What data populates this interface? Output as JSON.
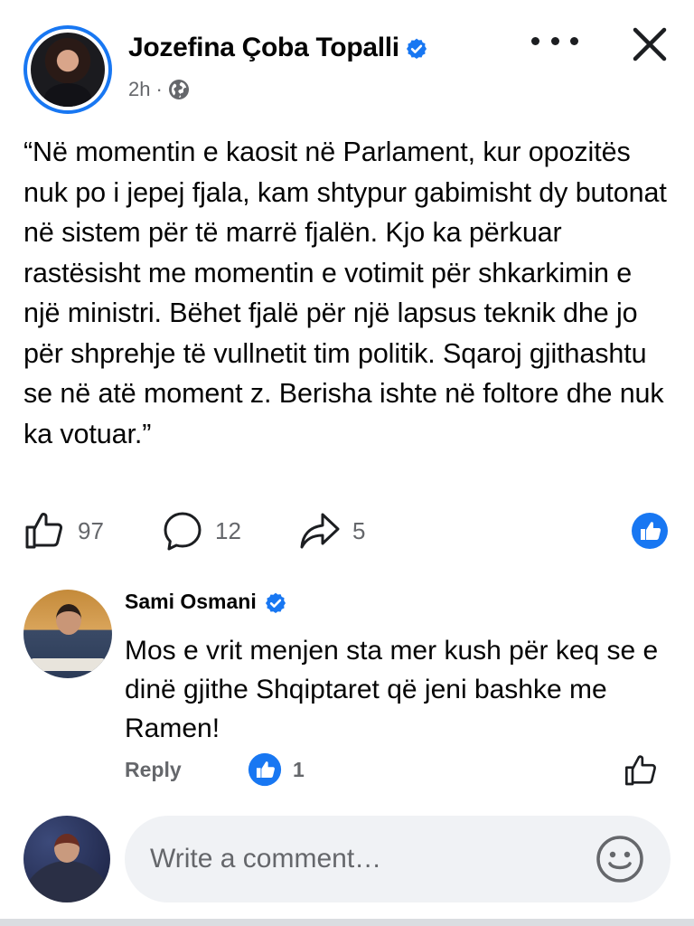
{
  "post": {
    "author": "Jozefina Çoba Topalli",
    "time": "2h",
    "separator": "·",
    "text": "“Në momentin e kaosit në Parlament, kur opozitës nuk po i jepej fjala, kam shtypur gabimisht dy butonat në sistem për të marrë fjalën. Kjo ka përkuar rastësisht me momentin e votimit për shkarkimin e një ministri. Bëhet fjalë për një lapsus teknik dhe jo për shprehje të vullnetit tim politik. Sqaroj gjithashtu se në atë moment z. Berisha ishte në foltore dhe nuk ka votuar.”",
    "likes": "97",
    "comments": "12",
    "shares": "5"
  },
  "comment": {
    "author": "Sami Osmani",
    "text": "Mos e vrit menjen sta mer kush për keq se e dinë gjithe Shqiptaret që jeni bashke me Ramen!",
    "reply_label": "Reply",
    "reaction_count": "1"
  },
  "composer": {
    "placeholder": "Write a comment…"
  },
  "icons": {
    "verified": "verified-badge-icon",
    "globe": "globe-icon",
    "more": "more-dots-icon",
    "close": "close-icon",
    "like": "thumbs-up-icon",
    "comment": "comment-bubble-icon",
    "share": "share-arrow-icon",
    "emoji": "smiley-icon"
  },
  "colors": {
    "accent": "#1877f2",
    "secondary_text": "#65676b",
    "input_bg": "#f0f2f5"
  }
}
